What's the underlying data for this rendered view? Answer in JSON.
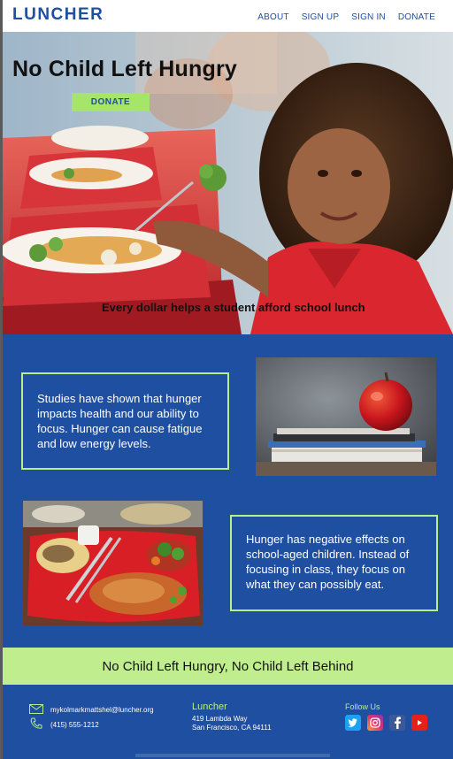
{
  "header": {
    "logo": "LUNCHER",
    "nav": [
      "ABOUT",
      "SIGN UP",
      "SIGN IN",
      "DONATE"
    ]
  },
  "hero": {
    "title": "No Child Left Hungry",
    "donate_label": "DONATE",
    "caption": "Every dollar helps a student afford school lunch"
  },
  "info": {
    "block1": "Studies have shown that hunger impacts health and our ability to focus.  Hunger can cause fatigue and low energy levels.",
    "block2": "Hunger has negative effects on school-aged children.  Instead of focusing in class, they focus on what they can possibly eat."
  },
  "banner": {
    "text": "No Child Left Hungry, No Child Left Behind"
  },
  "footer": {
    "email": "mykolmarkmattshel@luncher.org",
    "phone": "(415) 555-1212",
    "brand": "Luncher",
    "address_line1": "419 Lambda Way",
    "address_line2": "San Francisco, CA 94111",
    "follow_label": "Follow Us",
    "socials": [
      "twitter-icon",
      "instagram-icon",
      "facebook-icon",
      "youtube-icon"
    ]
  },
  "colors": {
    "primary_blue": "#1f4fa0",
    "accent_green": "#a7e56a",
    "banner_green": "#c0ee8f"
  }
}
